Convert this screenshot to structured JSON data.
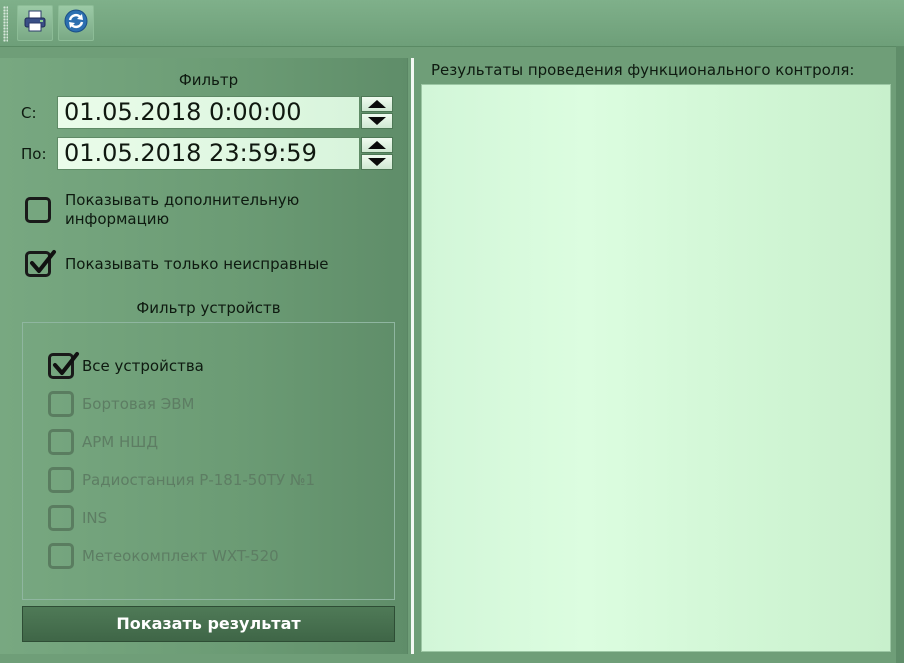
{
  "toolbar": {
    "print_icon": "printer-icon",
    "refresh_icon": "refresh-icon"
  },
  "filter": {
    "title": "Фильтр",
    "from_label": "С:",
    "from_value": "01.05.2018 0:00:00",
    "to_label": "По:",
    "to_value": "01.05.2018 23:59:59",
    "show_extra_label": "Показывать дополнительную информацию",
    "show_extra_checked": false,
    "only_faulty_label": "Показывать только неисправные",
    "only_faulty_checked": true
  },
  "device_filter": {
    "title": "Фильтр устройств",
    "items": [
      {
        "label": "Все устройства",
        "checked": true,
        "enabled": true
      },
      {
        "label": "Бортовая ЭВМ",
        "checked": false,
        "enabled": false
      },
      {
        "label": "АРМ НШД",
        "checked": false,
        "enabled": false
      },
      {
        "label": "Радиостанция Р-181-50ТУ №1",
        "checked": false,
        "enabled": false
      },
      {
        "label": "INS",
        "checked": false,
        "enabled": false
      },
      {
        "label": "Метеокомплект WXT-520",
        "checked": false,
        "enabled": false
      }
    ]
  },
  "show_button_label": "Показать результат",
  "results": {
    "title": "Результаты проведения функционального контроля:"
  },
  "colors": {
    "background": "#6f9e78",
    "results_bg": "#d4f7d9",
    "button_bg": "#45704e",
    "disabled_text": "#5d7d63"
  }
}
